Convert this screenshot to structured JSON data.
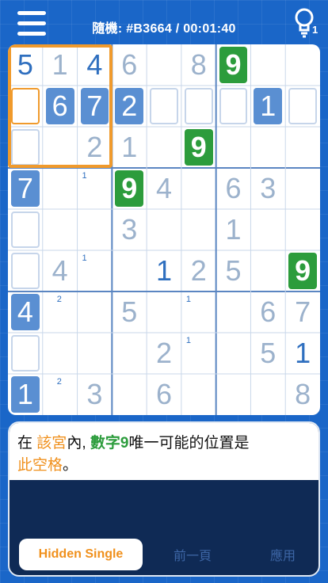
{
  "header": {
    "title": "隨機: #B3664 / 00:01:40",
    "hint_count": "1"
  },
  "board": {
    "rows": [
      [
        {
          "v": "5",
          "t": "given"
        },
        {
          "v": "1",
          "t": "entered"
        },
        {
          "v": "4",
          "t": "given"
        },
        {
          "v": "6",
          "t": "entered"
        },
        {
          "v": "",
          "t": ""
        },
        {
          "v": "8",
          "t": "entered"
        },
        {
          "v": "9",
          "t": "green"
        },
        {
          "v": "",
          "t": ""
        },
        {
          "v": "",
          "t": ""
        }
      ],
      [
        {
          "v": "",
          "t": "empty-orange"
        },
        {
          "v": "6",
          "t": "givenbg"
        },
        {
          "v": "7",
          "t": "givenbg"
        },
        {
          "v": "2",
          "t": "givenbg"
        },
        {
          "v": "",
          "t": "empty"
        },
        {
          "v": "",
          "t": "empty"
        },
        {
          "v": "",
          "t": "empty"
        },
        {
          "v": "1",
          "t": "givenbg"
        },
        {
          "v": "",
          "t": "empty"
        }
      ],
      [
        {
          "v": "",
          "t": "empty"
        },
        {
          "v": "",
          "t": ""
        },
        {
          "v": "2",
          "t": "entered"
        },
        {
          "v": "1",
          "t": "entered"
        },
        {
          "v": "",
          "t": ""
        },
        {
          "v": "9",
          "t": "green"
        },
        {
          "v": "",
          "t": ""
        },
        {
          "v": "",
          "t": ""
        },
        {
          "v": "",
          "t": ""
        }
      ],
      [
        {
          "v": "7",
          "t": "givenbg"
        },
        {
          "v": "",
          "t": ""
        },
        {
          "v": "",
          "t": "note",
          "n": "1"
        },
        {
          "v": "9",
          "t": "green"
        },
        {
          "v": "4",
          "t": "entered"
        },
        {
          "v": "",
          "t": ""
        },
        {
          "v": "6",
          "t": "entered"
        },
        {
          "v": "3",
          "t": "entered"
        },
        {
          "v": "",
          "t": ""
        }
      ],
      [
        {
          "v": "",
          "t": "empty"
        },
        {
          "v": "",
          "t": ""
        },
        {
          "v": "",
          "t": ""
        },
        {
          "v": "3",
          "t": "entered"
        },
        {
          "v": "",
          "t": ""
        },
        {
          "v": "",
          "t": ""
        },
        {
          "v": "1",
          "t": "entered"
        },
        {
          "v": "",
          "t": ""
        },
        {
          "v": "",
          "t": ""
        }
      ],
      [
        {
          "v": "",
          "t": "empty"
        },
        {
          "v": "4",
          "t": "entered"
        },
        {
          "v": "",
          "t": "note",
          "n": "1"
        },
        {
          "v": "",
          "t": ""
        },
        {
          "v": "1",
          "t": "given"
        },
        {
          "v": "2",
          "t": "entered"
        },
        {
          "v": "5",
          "t": "entered"
        },
        {
          "v": "",
          "t": ""
        },
        {
          "v": "9",
          "t": "green"
        }
      ],
      [
        {
          "v": "4",
          "t": "givenbg"
        },
        {
          "v": "",
          "t": "note",
          "n": "2"
        },
        {
          "v": "",
          "t": ""
        },
        {
          "v": "5",
          "t": "entered"
        },
        {
          "v": "",
          "t": ""
        },
        {
          "v": "",
          "t": "note",
          "n": "1"
        },
        {
          "v": "",
          "t": ""
        },
        {
          "v": "6",
          "t": "entered"
        },
        {
          "v": "7",
          "t": "entered"
        }
      ],
      [
        {
          "v": "",
          "t": "empty"
        },
        {
          "v": "",
          "t": ""
        },
        {
          "v": "",
          "t": ""
        },
        {
          "v": "",
          "t": ""
        },
        {
          "v": "2",
          "t": "entered"
        },
        {
          "v": "",
          "t": "note",
          "n": "1"
        },
        {
          "v": "",
          "t": ""
        },
        {
          "v": "5",
          "t": "entered"
        },
        {
          "v": "1",
          "t": "given"
        }
      ],
      [
        {
          "v": "1",
          "t": "givenbg"
        },
        {
          "v": "",
          "t": "note",
          "n": "2"
        },
        {
          "v": "3",
          "t": "entered"
        },
        {
          "v": "",
          "t": ""
        },
        {
          "v": "6",
          "t": "entered"
        },
        {
          "v": "",
          "t": ""
        },
        {
          "v": "",
          "t": ""
        },
        {
          "v": "",
          "t": ""
        },
        {
          "v": "8",
          "t": "entered"
        }
      ]
    ]
  },
  "explanation": {
    "p1": "在",
    "p2": "該宮",
    "p3": "內,",
    "p4": "數字9",
    "p5": "唯一可能的位置是",
    "p6": "此空格",
    "p7": "。"
  },
  "tabs": {
    "technique": "Hidden Single",
    "previous": "前一頁",
    "apply": "應用"
  },
  "colors": {
    "background": "#1a66c8",
    "accent_orange": "#f09a2c",
    "green": "#2c9c3c",
    "given_blue": "#5a8fd2"
  }
}
